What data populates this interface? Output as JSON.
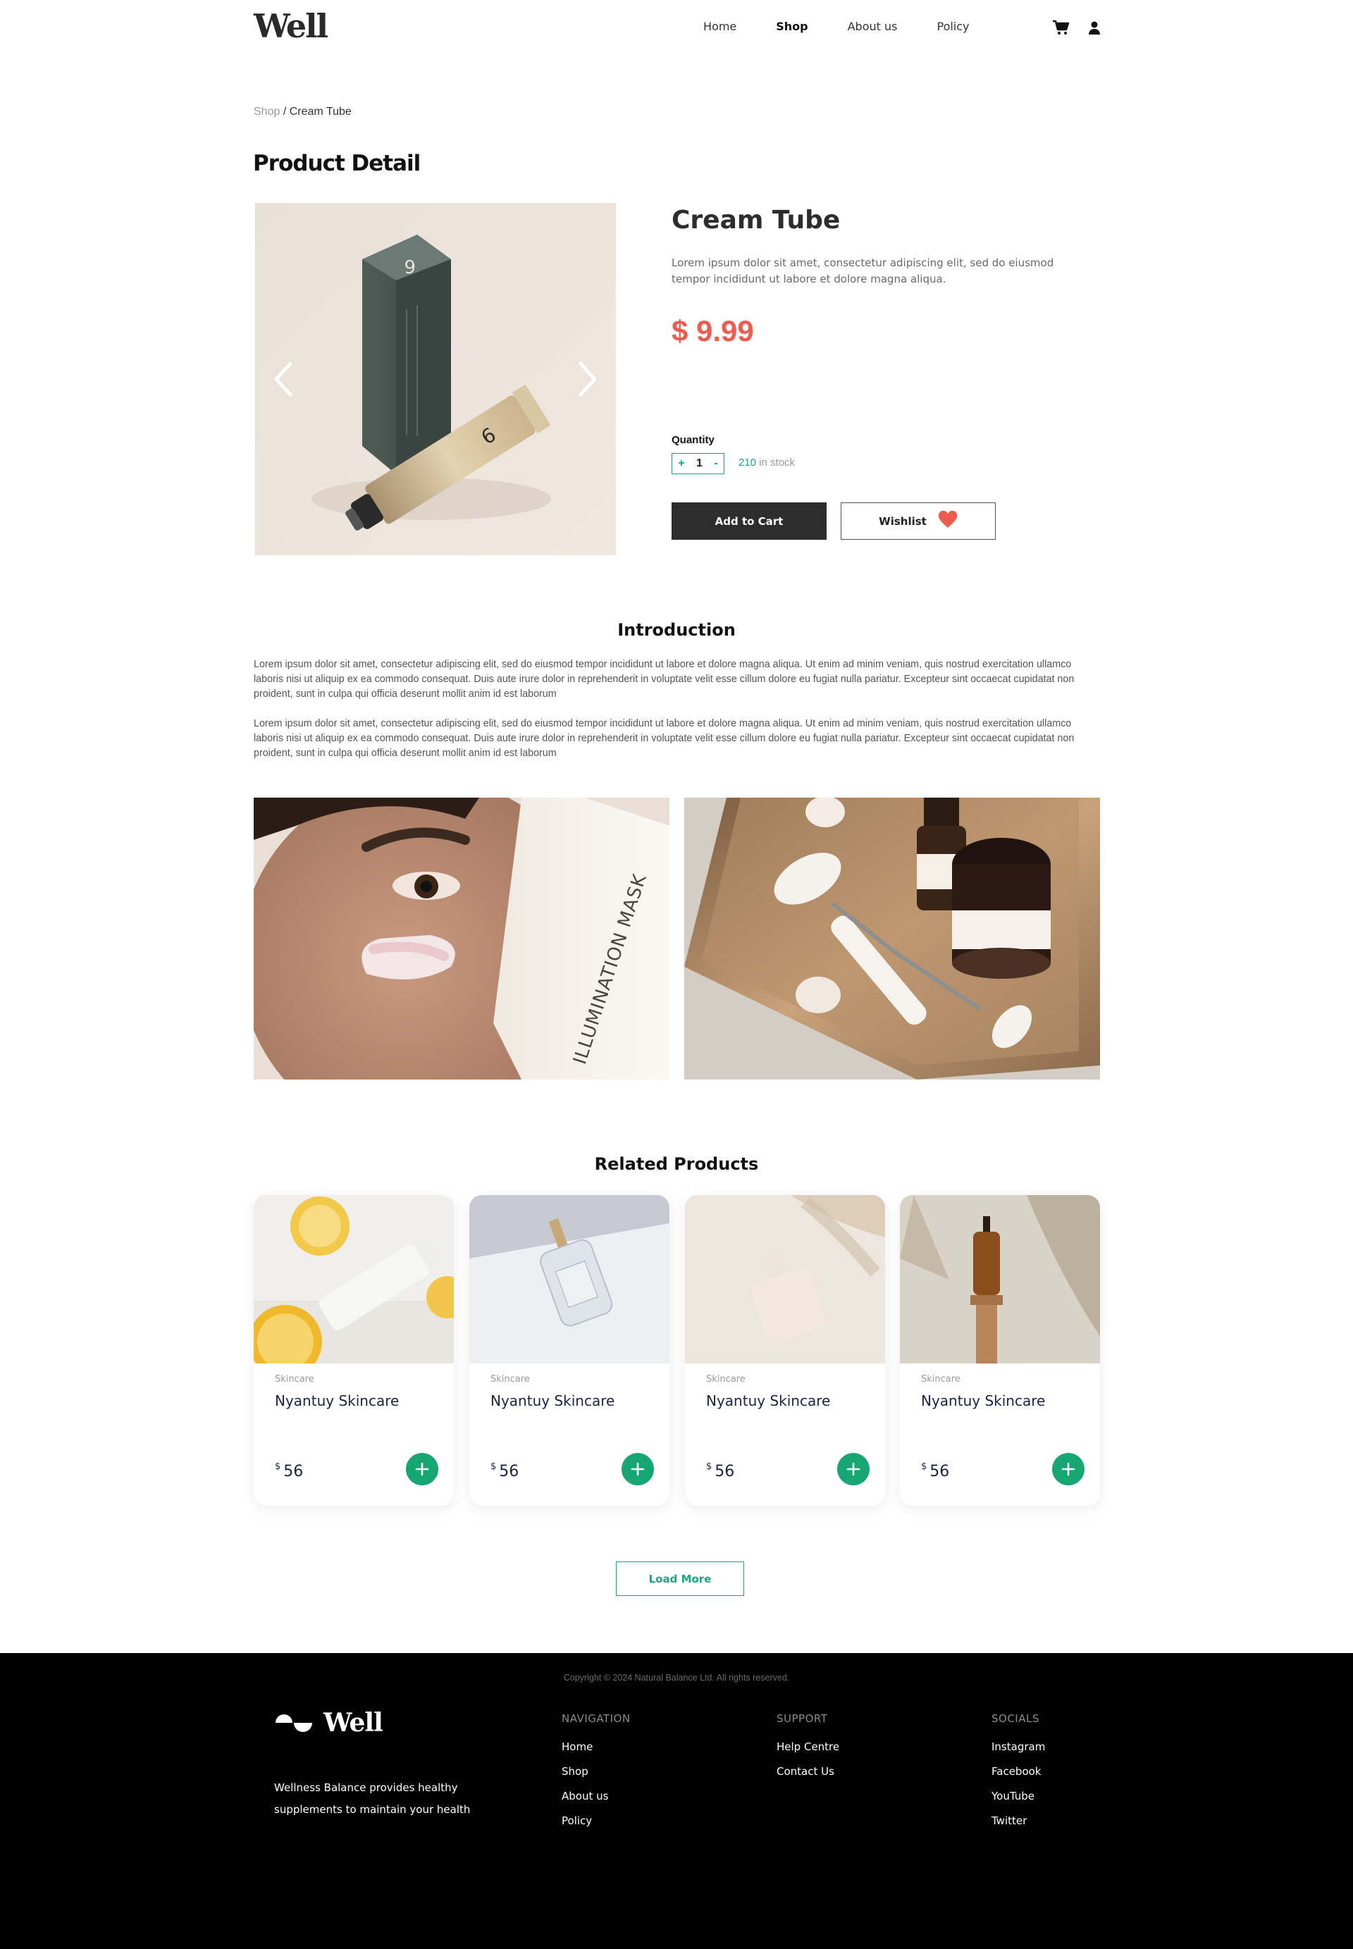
{
  "header": {
    "logo": "Well",
    "nav": [
      "Home",
      "Shop",
      "About us",
      "Policy"
    ],
    "active_nav": "Shop",
    "icons": [
      "cart-icon",
      "user-icon"
    ]
  },
  "breadcrumb": {
    "parent": "Shop",
    "separator": " / ",
    "current": "Cream Tube"
  },
  "page_title": "Product Detail",
  "product": {
    "name": "Cream Tube",
    "description": "Lorem ipsum dolor sit amet, consectetur adipiscing elit, sed do eiusmod tempor incididunt ut labore et dolore magna aliqua.",
    "price": "$ 9.99",
    "quantity_label": "Quantity",
    "quantity": "1",
    "plus": "+",
    "minus": "-",
    "stock_count": "210",
    "stock_text": " in stock",
    "add_to_cart": "Add to Cart",
    "wishlist": "Wishlist",
    "price_color": "#ee5c4f",
    "accent_color": "#18a880"
  },
  "intro": {
    "title": "Introduction",
    "paragraphs": [
      "Lorem ipsum dolor sit amet, consectetur adipiscing elit, sed do eiusmod tempor incididunt ut labore et dolore magna aliqua. Ut enim ad minim veniam, quis nostrud exercitation ullamco laboris nisi ut aliquip ex ea commodo consequat. Duis aute irure dolor in reprehenderit in voluptate velit esse cillum dolore eu fugiat nulla pariatur. Excepteur sint occaecat cupidatat non proident, sunt in culpa qui officia deserunt mollit anim id est laborum",
      "Lorem ipsum dolor sit amet, consectetur adipiscing elit, sed do eiusmod tempor incididunt ut labore et dolore magna aliqua. Ut enim ad minim veniam, quis nostrud exercitation ullamco laboris nisi ut aliquip ex ea commodo consequat. Duis aute irure dolor in reprehenderit in voluptate velit esse cillum dolore eu fugiat nulla pariatur. Excepteur sint occaecat cupidatat non proident, sunt in culpa qui officia deserunt mollit anim id est laborum"
    ],
    "mask_text": "ILLUMINATION MASK"
  },
  "related": {
    "title": "Related Products",
    "items": [
      {
        "category": "Skincare",
        "name": "Nyantuy Skincare",
        "currency": "$",
        "price": "56"
      },
      {
        "category": "Skincare",
        "name": "Nyantuy Skincare",
        "currency": "$",
        "price": "56"
      },
      {
        "category": "Skincare",
        "name": "Nyantuy Skincare",
        "currency": "$",
        "price": "56"
      },
      {
        "category": "Skincare",
        "name": "Nyantuy Skincare",
        "currency": "$",
        "price": "56"
      }
    ],
    "load_more": "Load More"
  },
  "footer": {
    "logo": "Well",
    "tagline": "Wellness Balance provides healthy supplements to maintain your health",
    "navigation": {
      "title": "NAVIGATION",
      "links": [
        "Home",
        "Shop",
        "About us",
        "Policy"
      ]
    },
    "support": {
      "title": "SUPPORT",
      "links": [
        "Help Centre",
        "Contact Us"
      ]
    },
    "socials": {
      "title": "SOCIALS",
      "links": [
        "Instagram",
        "Facebook",
        "YouTube",
        "Twitter"
      ]
    },
    "copyright": "Copyright © 2024 Natural Balance Ltd. All rights reserved."
  }
}
